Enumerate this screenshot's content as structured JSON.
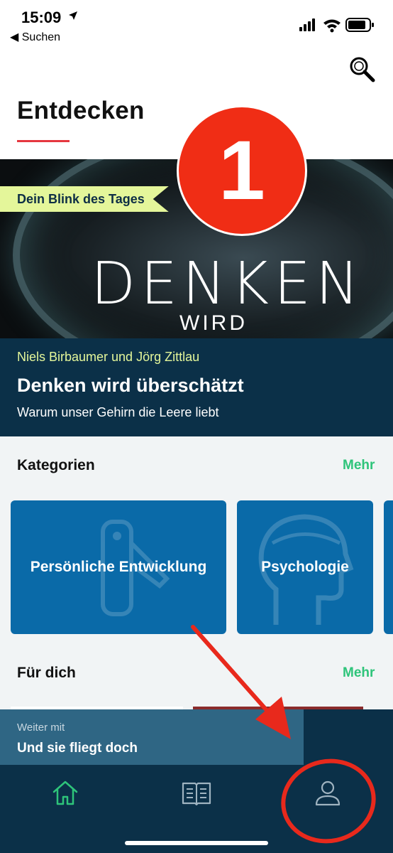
{
  "status_bar": {
    "time": "15:09",
    "back_label": "◀ Suchen"
  },
  "header": {
    "title": "Entdecken",
    "search_icon": "search-icon"
  },
  "hero": {
    "flag_label": "Dein Blink des Tages",
    "cover_word_1": "DENKEN",
    "cover_word_2": "WIRD",
    "badge_number": "1"
  },
  "blink": {
    "author": "Niels Birbaumer und Jörg Zittlau",
    "title": "Denken wird überschätzt",
    "subtitle": "Warum unser Gehirn die Leere liebt"
  },
  "categories": {
    "title": "Kategorien",
    "more_label": "Mehr",
    "items": [
      {
        "label": "Persönliche Entwicklung"
      },
      {
        "label": "Psychologie"
      }
    ]
  },
  "for_you": {
    "title": "Für dich",
    "more_label": "Mehr"
  },
  "continue": {
    "label": "Weiter mit",
    "title": "Und sie fliegt doch"
  },
  "tabbar": {
    "items": [
      {
        "icon": "home-icon",
        "active": true
      },
      {
        "icon": "library-icon",
        "active": false
      },
      {
        "icon": "profile-icon",
        "active": false
      }
    ]
  },
  "colors": {
    "accent_red": "#e5373f",
    "accent_green": "#2ec47a",
    "navy": "#0b3048",
    "category_blue": "#0a6aa8",
    "highlight_yellow": "#e4f69a"
  }
}
